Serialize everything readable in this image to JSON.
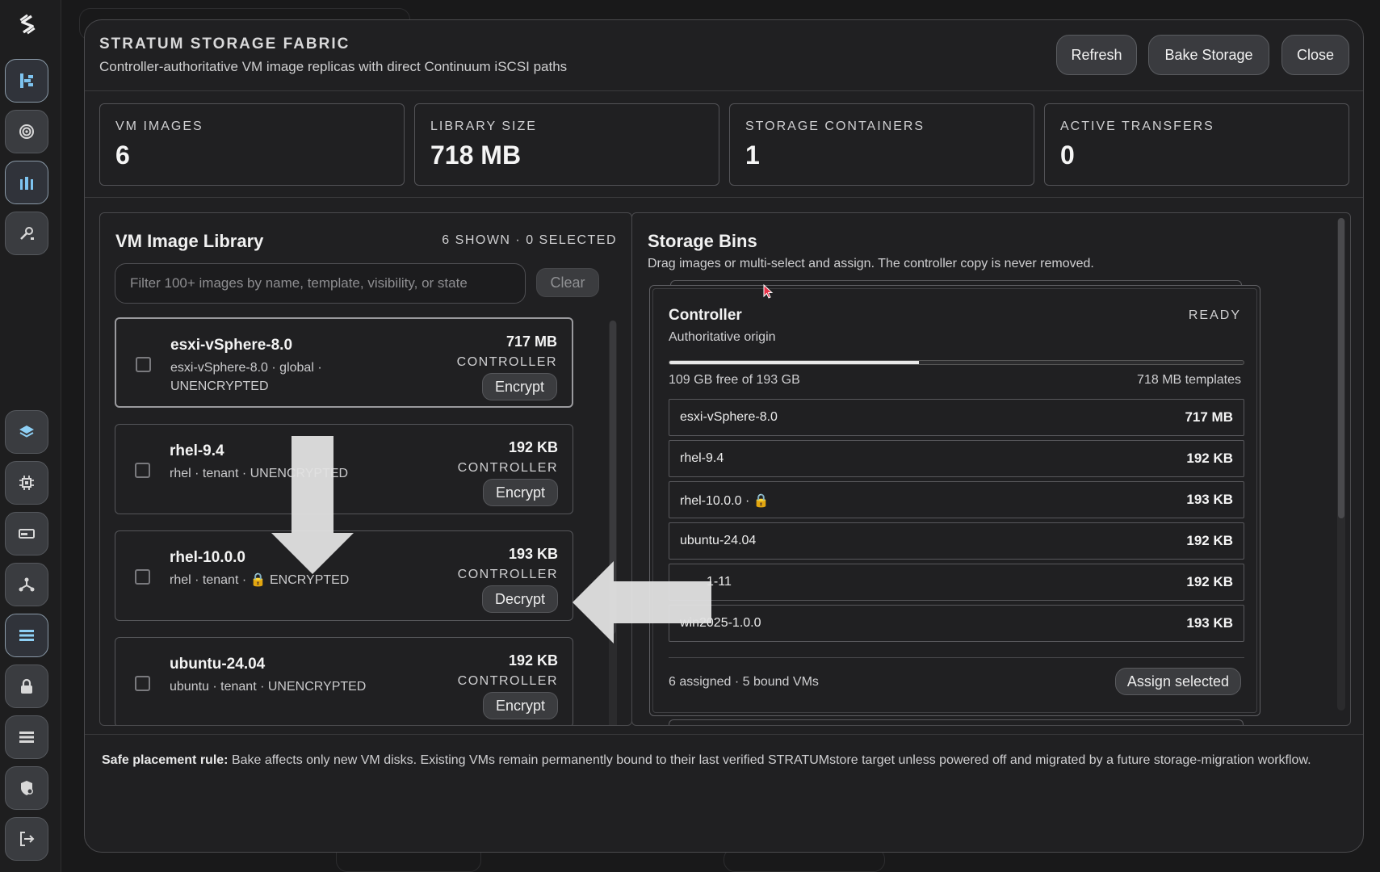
{
  "header": {
    "title": "STRATUM STORAGE FABRIC",
    "subtitle": "Controller-authoritative VM image replicas with direct Continuum iSCSI paths",
    "refresh_label": "Refresh",
    "bake_label": "Bake Storage",
    "close_label": "Close"
  },
  "stats": [
    {
      "label": "VM IMAGES",
      "value": "6"
    },
    {
      "label": "LIBRARY SIZE",
      "value": "718 MB"
    },
    {
      "label": "STORAGE CONTAINERS",
      "value": "1"
    },
    {
      "label": "ACTIVE TRANSFERS",
      "value": "0"
    }
  ],
  "library": {
    "title": "VM Image Library",
    "meta": "6 SHOWN · 0 SELECTED",
    "filter_placeholder": "Filter 100+ images by name, template, visibility, or state",
    "filter_value": "",
    "clear_label": "Clear",
    "items": [
      {
        "name": "esxi-vSphere-8.0",
        "meta": "esxi-vSphere-8.0 · global · UNENCRYPTED",
        "size": "717 MB",
        "location": "CONTROLLER",
        "action": "Encrypt"
      },
      {
        "name": "rhel-9.4",
        "meta": "rhel · tenant · UNENCRYPTED",
        "size": "192 KB",
        "location": "CONTROLLER",
        "action": "Encrypt"
      },
      {
        "name": "rhel-10.0.0",
        "meta": "rhel · tenant · 🔒 ENCRYPTED",
        "size": "193 KB",
        "location": "CONTROLLER",
        "action": "Decrypt"
      },
      {
        "name": "ubuntu-24.04",
        "meta": "ubuntu · tenant · UNENCRYPTED",
        "size": "192 KB",
        "location": "CONTROLLER",
        "action": "Encrypt"
      }
    ]
  },
  "bins": {
    "title": "Storage Bins",
    "subtitle": "Drag images or multi-select and assign. The controller copy is never removed.",
    "controller": {
      "name": "Controller",
      "status": "READY",
      "origin": "Authoritative origin",
      "used_fraction": 0.435,
      "free_text": "109 GB free of 193 GB",
      "templates_text": "718 MB templates",
      "rows": [
        {
          "name": "esxi-vSphere-8.0",
          "size": "717 MB"
        },
        {
          "name": "rhel-9.4",
          "size": "192 KB"
        },
        {
          "name": "rhel-10.0.0 · 🔒",
          "size": "193 KB"
        },
        {
          "name": "ubuntu-24.04",
          "size": "192 KB"
        },
        {
          "name": "1-11",
          "size": "192 KB"
        },
        {
          "name": "win2025-1.0.0",
          "size": "193 KB"
        }
      ],
      "footer": "6 assigned · 5 bound VMs",
      "assign_label": "Assign selected"
    }
  },
  "footer": {
    "rule_label": "Safe placement rule:",
    "rule_text": " Bake affects only new VM disks. Existing VMs remain permanently bound to their last verified STRATUMstore target unless powered off and migrated by a future storage-migration workflow."
  },
  "rail_icons": [
    "stratum-logo-icon",
    "topology-icon",
    "target-icon",
    "cluster-icon",
    "tools-icon",
    "layers-icon",
    "chip-icon",
    "storage-drive-icon",
    "network-icon",
    "list-active-icon",
    "lock-icon",
    "list-icon",
    "shield-gear-icon",
    "logout-icon"
  ]
}
